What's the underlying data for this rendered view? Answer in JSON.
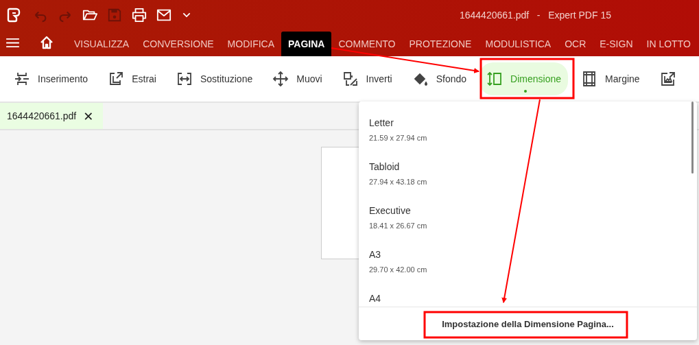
{
  "window": {
    "title": "1644420661.pdf   -   Expert PDF 15"
  },
  "quick_actions": [
    {
      "kind": "undo",
      "disabled": true
    },
    {
      "kind": "redo",
      "disabled": true
    },
    {
      "kind": "open",
      "disabled": false
    },
    {
      "kind": "save",
      "disabled": true
    },
    {
      "kind": "print",
      "disabled": false
    },
    {
      "kind": "mail",
      "disabled": false
    },
    {
      "kind": "more",
      "disabled": false
    }
  ],
  "tabs": [
    {
      "label": "VISUALIZZA",
      "selected": false
    },
    {
      "label": "CONVERSIONE",
      "selected": false
    },
    {
      "label": "MODIFICA",
      "selected": false
    },
    {
      "label": "PAGINA",
      "selected": true
    },
    {
      "label": "COMMENTO",
      "selected": false
    },
    {
      "label": "PROTEZIONE",
      "selected": false
    },
    {
      "label": "MODULISTICA",
      "selected": false
    },
    {
      "label": "OCR",
      "selected": false
    },
    {
      "label": "E-SIGN",
      "selected": false
    },
    {
      "label": "IN LOTTO",
      "selected": false
    }
  ],
  "toolbar": [
    {
      "kind": "insert",
      "label": "Inserimento",
      "selected": false
    },
    {
      "kind": "extract",
      "label": "Estrai",
      "selected": false
    },
    {
      "kind": "replace",
      "label": "Sostituzione",
      "selected": false
    },
    {
      "kind": "move",
      "label": "Muovi",
      "selected": false
    },
    {
      "kind": "swap",
      "label": "Inverti",
      "selected": false
    },
    {
      "kind": "background",
      "label": "Sfondo",
      "selected": false
    },
    {
      "kind": "size",
      "label": "Dimensione",
      "selected": true
    },
    {
      "kind": "margin",
      "label": "Margine",
      "selected": false
    },
    {
      "kind": "export",
      "selected": false
    }
  ],
  "document_tab": {
    "label": "1644420661.pdf",
    "close": "✕"
  },
  "size_menu": {
    "items": [
      {
        "name": "Letter",
        "size": "21.59 x 27.94 cm"
      },
      {
        "name": "Tabloid",
        "size": "27.94 x 43.18 cm"
      },
      {
        "name": "Executive",
        "size": "18.41 x 26.67 cm"
      },
      {
        "name": "A3",
        "size": "29.70 x 42.00 cm"
      },
      {
        "name": "A4"
      }
    ],
    "footer_button": "Impostazione della Dimensione Pagina..."
  }
}
